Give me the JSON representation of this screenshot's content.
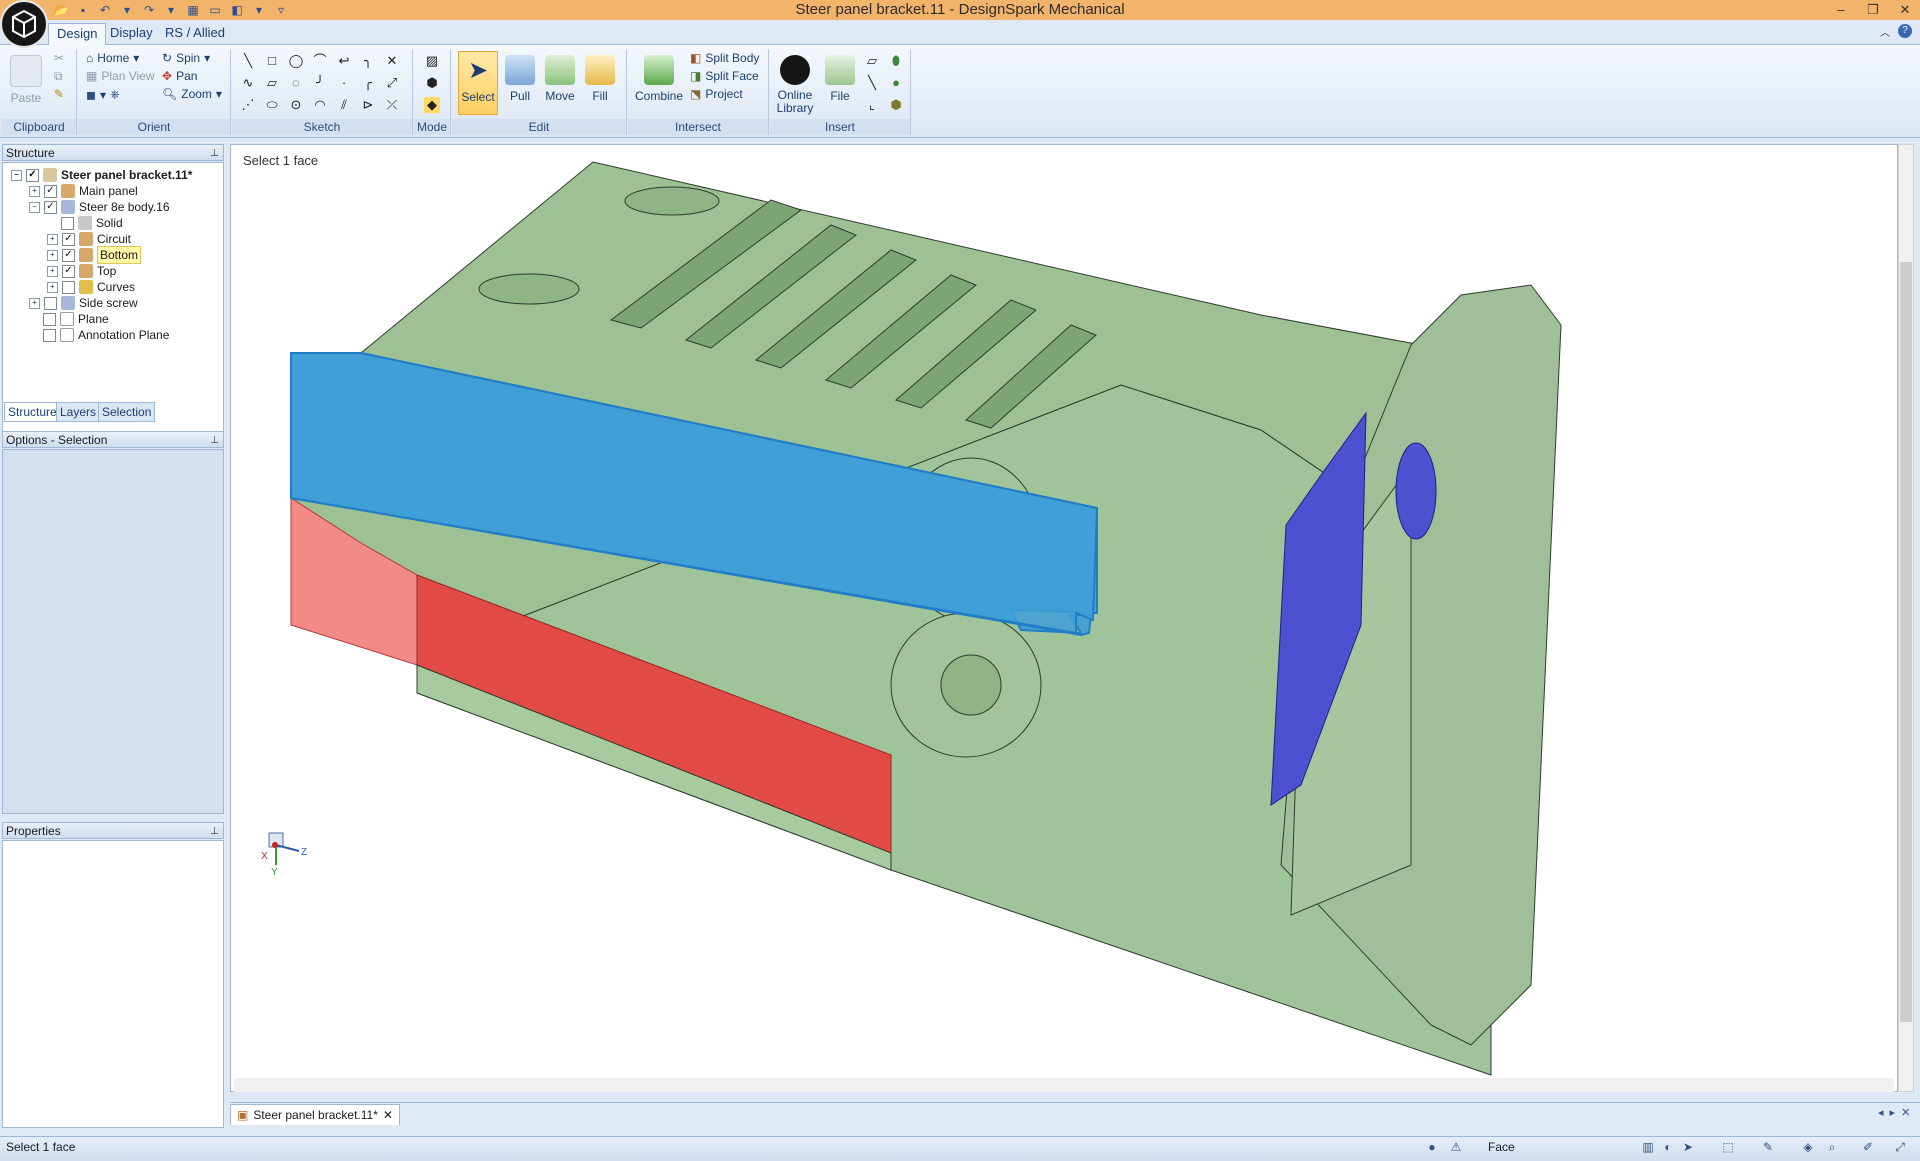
{
  "window": {
    "title": "Steer panel bracket.11 - DesignSpark Mechanical"
  },
  "ribbon_tabs": [
    "Design",
    "Display",
    "RS / Allied"
  ],
  "ribbon": {
    "clipboard": {
      "label": "Clipboard",
      "paste": "Paste"
    },
    "orient": {
      "label": "Orient",
      "home": "Home",
      "plan_view": "Plan View",
      "spin": "Spin",
      "pan": "Pan",
      "zoom": "Zoom"
    },
    "sketch": {
      "label": "Sketch"
    },
    "mode": {
      "label": "Mode"
    },
    "edit": {
      "label": "Edit",
      "select": "Select",
      "pull": "Pull",
      "move": "Move",
      "fill": "Fill"
    },
    "intersect": {
      "label": "Intersect",
      "combine": "Combine",
      "split_body": "Split Body",
      "split_face": "Split Face",
      "project": "Project"
    },
    "insert": {
      "label": "Insert",
      "online_library_1": "Online",
      "online_library_2": "Library",
      "file": "File"
    }
  },
  "structure_panel": {
    "title": "Structure",
    "tree": [
      {
        "label": "Steer panel bracket.11*",
        "checked": true
      },
      {
        "label": "Main panel",
        "checked": true
      },
      {
        "label": "Steer 8e body.16",
        "checked": true
      },
      {
        "label": "Solid",
        "checked": false
      },
      {
        "label": "Circuit",
        "checked": true
      },
      {
        "label": "Bottom",
        "checked": true
      },
      {
        "label": "Top",
        "checked": true
      },
      {
        "label": "Curves",
        "checked": false
      },
      {
        "label": "Side screw",
        "checked": false
      },
      {
        "label": "Plane",
        "checked": false
      },
      {
        "label": "Annotation Plane",
        "checked": false
      }
    ],
    "tabs": [
      "Structure",
      "Layers",
      "Selection"
    ]
  },
  "options_panel": {
    "title": "Options - Selection"
  },
  "properties_panel": {
    "title": "Properties"
  },
  "viewport": {
    "hint": "Select 1 face",
    "axes": {
      "x": "X",
      "y": "Y",
      "z": "Z"
    }
  },
  "document_tab": {
    "label": "Steer panel bracket.11*"
  },
  "status": {
    "text": "Select 1 face",
    "mode": "Face"
  },
  "colors": {
    "title_bar": "#f2b36b",
    "model_green": "#a4c8a0",
    "selection_blue": "#3f9fd8",
    "section_red": "#f07a78",
    "internal_blue": "#4455cc"
  }
}
